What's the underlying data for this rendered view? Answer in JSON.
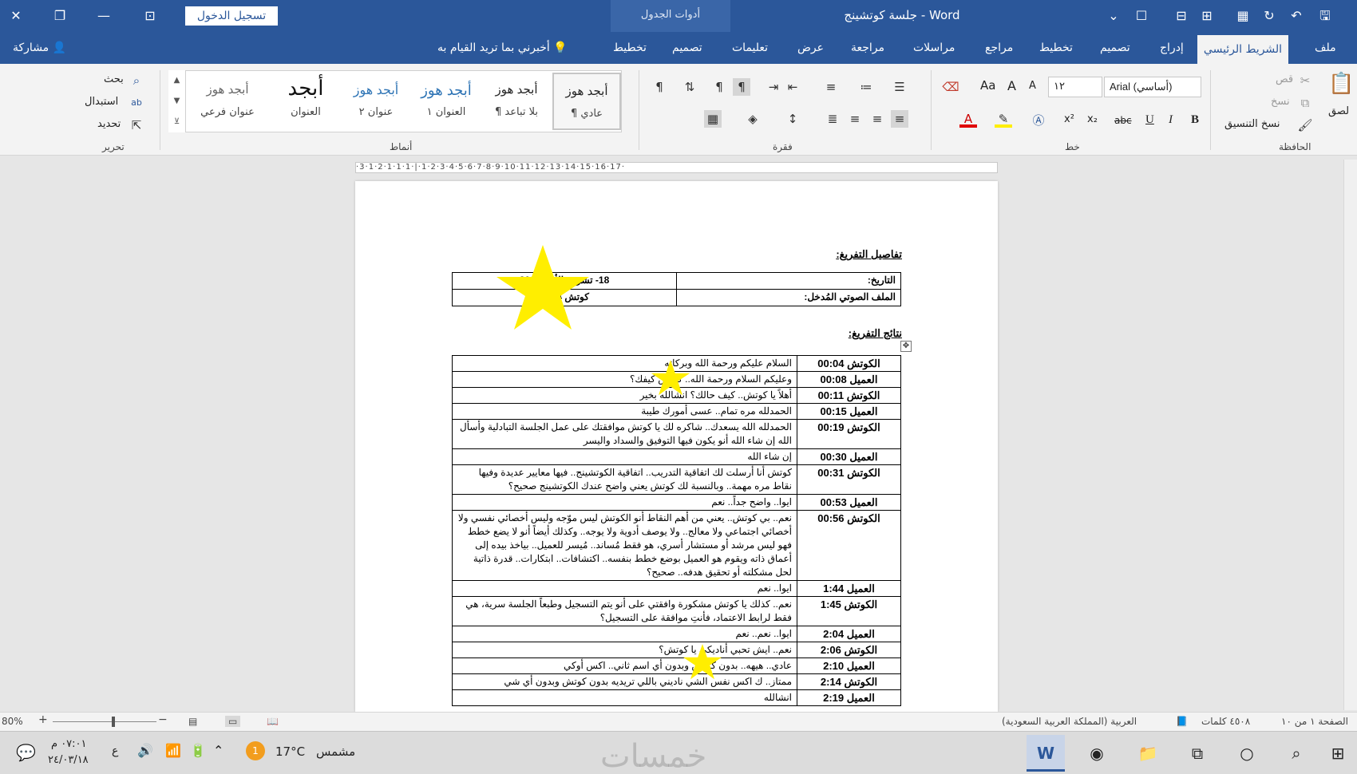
{
  "titlebar": {
    "doc_title": "جلسة كوتشينج - Word",
    "table_tools": "أدوات الجدول",
    "login_button": "تسجيل الدخول"
  },
  "tabs": [
    {
      "label": "ملف"
    },
    {
      "label": "الشريط الرئيسي"
    },
    {
      "label": "إدراج"
    },
    {
      "label": "تصميم"
    },
    {
      "label": "تخطيط"
    },
    {
      "label": "مراجع"
    },
    {
      "label": "مراسلات"
    },
    {
      "label": "مراجعة"
    },
    {
      "label": "عرض"
    },
    {
      "label": "تعليمات"
    },
    {
      "label": "تصميم"
    },
    {
      "label": "تخطيط"
    }
  ],
  "tell_me": "أخبرني بما تريد القيام به",
  "share": "مشاركة",
  "ribbon": {
    "clipboard": {
      "group": "الحافظة",
      "paste": "لصق",
      "cut": "قص",
      "copy": "نسخ",
      "format_painter": "نسخ التنسيق"
    },
    "font": {
      "group": "خط",
      "font_name": "Arial (أساسي)",
      "font_size": "١٢",
      "bold": "B",
      "italic": "I",
      "underline": "U",
      "strike": "abc",
      "subscript": "x₂",
      "superscript": "x²",
      "grow": "A",
      "shrink": "A",
      "case": "Aa"
    },
    "paragraph": {
      "group": "فقرة"
    },
    "styles": {
      "group": "أنماط",
      "items": [
        {
          "sample": "أبجد هوز",
          "name": "¶ عادي"
        },
        {
          "sample": "أبجد هوز",
          "name": "¶ بلا تباعد"
        },
        {
          "sample": "أبجد هوز",
          "name": "العنوان ١"
        },
        {
          "sample": "أبجد هوز",
          "name": "عنوان ٢"
        },
        {
          "sample": "أبجد",
          "name": "العنوان"
        },
        {
          "sample": "أبجد هوز",
          "name": "عنوان فرعي"
        }
      ]
    },
    "editing": {
      "group": "تحرير",
      "find": "بحث",
      "replace": "استبدال",
      "select": "تحديد"
    }
  },
  "ruler": "·3·1·2·1·1·1·|·1·2·3·4·5·6·7·8·9·10·11·12·13·14·15·16·17·",
  "document": {
    "details_heading": "تفاصيل التفريغ:",
    "details": [
      {
        "label": "التاريخ:",
        "value": "18- تشرين الأول-2023"
      },
      {
        "label": "الملف الصوتي المُدخل:",
        "value": "كوتش MP4."
      }
    ],
    "results_heading": "نتائج التفريغ:",
    "rows": [
      {
        "speaker": "الكوتش 00:04",
        "text": "السلام عليكم ورحمة الله وبركاته"
      },
      {
        "speaker": "العميل 00:08",
        "text": "وعليكم السلام ورحمة الله.. كوتش كيفك؟"
      },
      {
        "speaker": "الكوتش 00:11",
        "text": "أهلاً يا كوتش.. كيف حالك؟ انشالله بخير"
      },
      {
        "speaker": "العميل 00:15",
        "text": "الحمدلله مره تمام.. عسى أمورك طيبة"
      },
      {
        "speaker": "الكوتش 00:19",
        "text": "الحمدلله الله يسعدك.. شاكره لك يا كوتش موافقتك على عمل الجلسة التبادلية وأسأل الله إن شاء الله أنو يكون فيها التوفيق والسداد واليسر"
      },
      {
        "speaker": "العميل 00:30",
        "text": "إن شاء الله"
      },
      {
        "speaker": "الكوتش 00:31",
        "text": "كوتش أنا أرسلت لك اتفاقية التدريب.. اتفاقية الكوتشينج.. فيها معايير عديدة وفيها نقاط مره مهمة.. وبالنسبة لك كوتش يعني واضح عندك الكوتشينج صحيح؟"
      },
      {
        "speaker": "العميل 00:53",
        "text": "ايوا.. واضح جداً.. نعم"
      },
      {
        "speaker": "الكوتش 00:56",
        "text": "نعم.. بي كوتش.. يعني من أهم النقاط أنو الكوتش ليس موّجه وليس أخصائي نفسي ولا أخصائي اجتماعي ولا معالج.. ولا يوصف أدوية ولا يوجه.. وكذلك أيضاً أنو لا يضع خطط فهو ليس مرشد أو مستشار أسري، هو فقط مُساند.. مُيسر للعميل.. بياخذ بيده إلى أعماق ذاته ويقوم هو العميل بوضع خطط بنفسه.. اكتشافات.. ابتكارات.. قدرة ذاتية لحل مشكلته أو تحقيق هدفه.. صحيح؟"
      },
      {
        "speaker": "العميل 1:44",
        "text": "ايوا.. نعم"
      },
      {
        "speaker": "الكوتش 1:45",
        "text": "نعم.. كذلك يا كوتش مشكورة وافقتي على أنو يتم التسجيل وطبعاً الجلسة سرية، هي فقط لرابط الاعتماد، فأنتِ موافقة على التسجيل؟"
      },
      {
        "speaker": "العميل 2:04",
        "text": "ايوا.. نعم.. نعم"
      },
      {
        "speaker": "الكوتش 2:06",
        "text": "نعم.. ايش تحبي أناديكي يا كوتش؟"
      },
      {
        "speaker": "العميل 2:10",
        "text": "عادي.. هيهه.. بدون كوتش وبدون أي اسم ثاني.. اكس أوكي"
      },
      {
        "speaker": "الكوتش 2:14",
        "text": "ممتاز.. ك اكس نفس الشي ناديني باللي تريديه بدون كوتش وبدون أي شي"
      },
      {
        "speaker": "العميل 2:19",
        "text": "انشالله"
      }
    ]
  },
  "statusbar": {
    "page": "الصفحة ١ من ١٠",
    "words": "٤٥٠٨ كلمات",
    "language": "العربية (المملكة العربية السعودية)",
    "zoom": "80%"
  },
  "taskbar": {
    "time": "٠٧:٠١ م",
    "date": "٢٤/٠٣/١٨",
    "lang": "ع",
    "weather_temp": "17°C",
    "weather_text": "مشمس",
    "notification_count": "1",
    "watermark": "خمسات"
  },
  "colors": {
    "word_blue": "#2b579a",
    "star_yellow": "#ffee00"
  }
}
